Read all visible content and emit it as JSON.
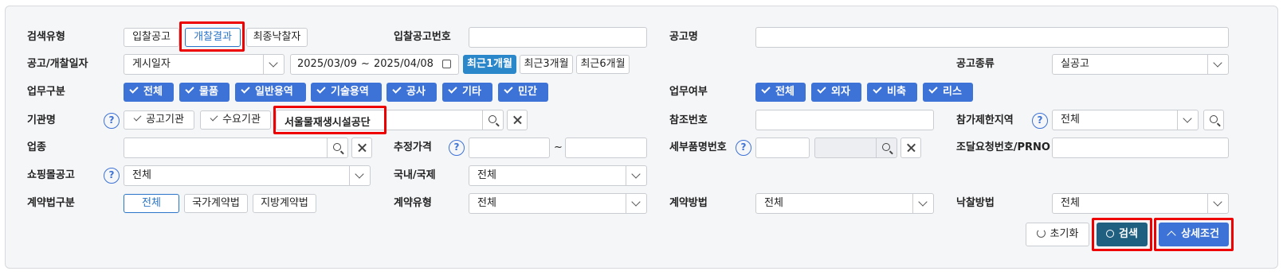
{
  "row1": {
    "search_type_label": "검색유형",
    "search_type_options": [
      "입찰공고",
      "개찰결과",
      "최종낙찰자"
    ],
    "bid_no_label": "입찰공고번호",
    "bid_no_value": "",
    "notice_name_label": "공고명",
    "notice_name_value": ""
  },
  "row2": {
    "date_label": "공고/개찰일자",
    "date_type_value": "게시일자",
    "date_from": "2025/03/09",
    "date_sep": "~",
    "date_to": "2025/04/08",
    "period_buttons": [
      "최근1개월",
      "최근3개월",
      "최근6개월"
    ],
    "notice_kind_label": "공고종류",
    "notice_kind_value": "실공고"
  },
  "row3": {
    "work_label": "업무구분",
    "work_chips": [
      "전체",
      "물품",
      "일반용역",
      "기술용역",
      "공사",
      "기타",
      "민간"
    ],
    "work_yn_label": "업무여부",
    "work_yn_chips": [
      "전체",
      "외자",
      "비축",
      "리스"
    ]
  },
  "row4": {
    "org_label": "기관명",
    "help": "?",
    "org_type_buttons": [
      "공고기관",
      "수요기관"
    ],
    "org_value": "서울물재생시설공단",
    "ref_no_label": "참조번호",
    "ref_no_value": "",
    "region_label": "참가제한지역",
    "region_value": "전체"
  },
  "row5": {
    "industry_label": "업종",
    "industry_value": "",
    "price_label": "추정가격",
    "price_sep": "~",
    "detail_no_label": "세부품명번호",
    "procure_no_label": "조달요청번호/PRNO"
  },
  "row6": {
    "mall_label": "쇼핑몰공고",
    "mall_value": "전체",
    "domestic_label": "국내/국제",
    "domestic_value": "전체"
  },
  "row7": {
    "law_label": "계약법구분",
    "law_buttons": [
      "전체",
      "국가계약법",
      "지방계약법"
    ],
    "contract_type_label": "계약유형",
    "contract_type_value": "전체",
    "contract_method_label": "계약방법",
    "contract_method_value": "전체",
    "award_method_label": "낙찰방법",
    "award_method_value": "전체"
  },
  "actions": {
    "reset": "초기화",
    "search": "검색",
    "detail": "상세조건"
  },
  "colors": {
    "primary": "#3d72d6",
    "search_btn": "#1f5f80",
    "highlight": "#ee0000"
  }
}
